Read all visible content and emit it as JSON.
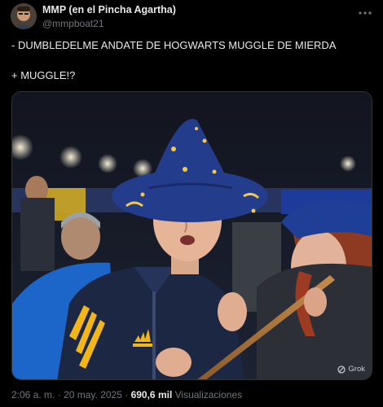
{
  "author": {
    "display_name": "MMP (en el Pincha Agartha)",
    "handle": "@mmpboat21"
  },
  "tweet": {
    "line1": "- DUMBLEDELME ANDATE DE HOGWARTS MUGGLE DE MIERDA",
    "line2": "+ MUGGLE!?"
  },
  "media": {
    "badge_label": "Grok"
  },
  "meta": {
    "time": "2:06 a. m.",
    "separator": "·",
    "date": "20 may. 2025",
    "views_count": "690,6 mil",
    "views_label": "Visualizaciones"
  },
  "icons": {
    "more": "more-icon",
    "grok": "grok-icon"
  },
  "colors": {
    "background": "#000000",
    "text": "#e7e9ea",
    "muted": "#71767b",
    "hat": "#243c8c",
    "jacket": "#1c2744",
    "stripe": "#f2b619"
  }
}
